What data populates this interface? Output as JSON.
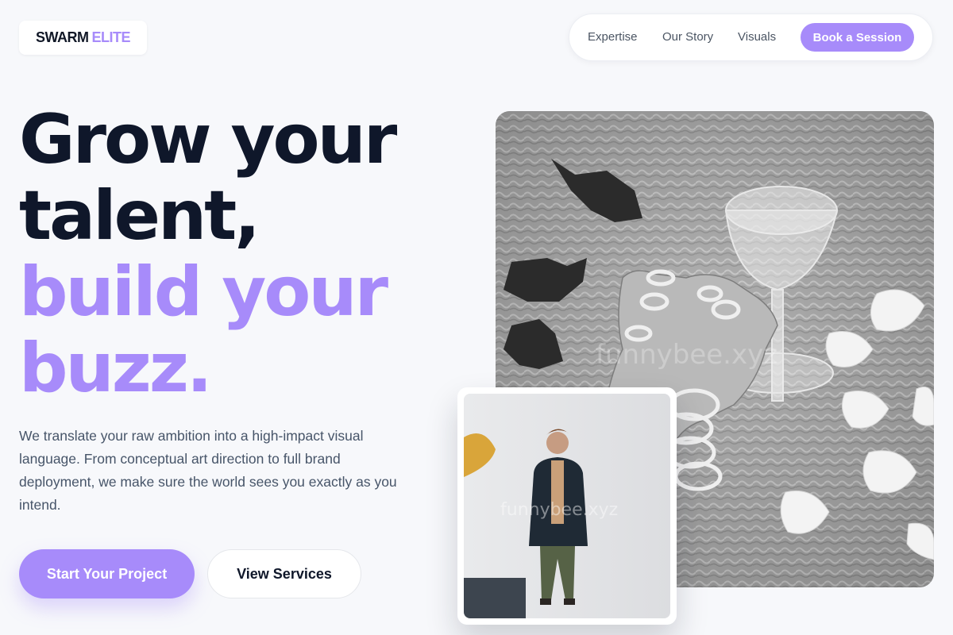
{
  "brand": {
    "name_part1": "SWARM",
    "name_part2": "ELITE",
    "accent_color": "#a78bfa"
  },
  "nav": {
    "links": [
      {
        "label": "Expertise"
      },
      {
        "label": "Our Story"
      },
      {
        "label": "Visuals"
      }
    ],
    "cta_label": "Book a Session"
  },
  "hero": {
    "title_lines": [
      {
        "text": "Grow your"
      },
      {
        "text": "talent,"
      },
      {
        "text": "build your"
      },
      {
        "text": "buzz."
      }
    ],
    "description": "We translate your raw ambition into a high-impact visual language. From conceptual art direction to full brand deployment, we make sure the world sees you exactly as you intend.",
    "primary_button": "Start Your Project",
    "secondary_button": "View Services"
  },
  "images": {
    "main_watermark": "funnybee.xyz",
    "card_watermark": "funnybee.xyz"
  }
}
